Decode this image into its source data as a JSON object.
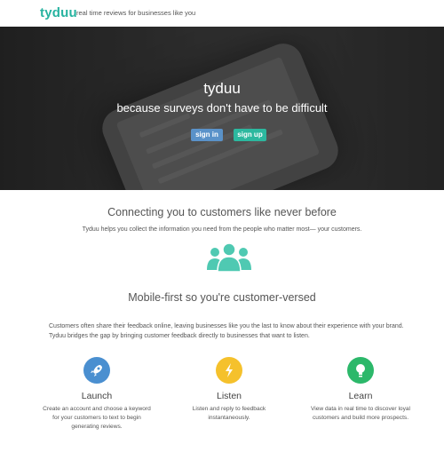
{
  "header": {
    "brand": "tyduu",
    "tagline": "real time reviews for businesses like you"
  },
  "hero": {
    "title": "tyduu",
    "subtitle": "because surveys don't have to be difficult",
    "signin_label": "sign in",
    "signup_label": "sign up"
  },
  "section_connect": {
    "title": "Connecting you to customers like never before",
    "text": "Tyduu helps you collect the information you need from the people who matter most— your customers."
  },
  "section_mobile": {
    "title": "Mobile-first so you're customer-versed",
    "text": "Customers often share their feedback online, leaving businesses like you the last to know about their experience with your brand. Tyduu bridges the gap by bringing customer feedback directly to businesses that want to listen."
  },
  "features": [
    {
      "title": "Launch",
      "text": "Create an account and choose a keyword for your customers to text to begin generating reviews.",
      "icon": "rocket-icon",
      "color": "#4a8fd0"
    },
    {
      "title": "Listen",
      "text": "Listen and reply to feedback instantaneously.",
      "icon": "lightning-icon",
      "color": "#f5c12c"
    },
    {
      "title": "Learn",
      "text": "View data in real time to discover loyal customers and build more prospects.",
      "icon": "lightbulb-icon",
      "color": "#2cb86a"
    }
  ],
  "colors": {
    "brand": "#27b3a0",
    "signin": "#5a92c9",
    "signup": "#2cb89f",
    "people": "#4fc9b2"
  }
}
